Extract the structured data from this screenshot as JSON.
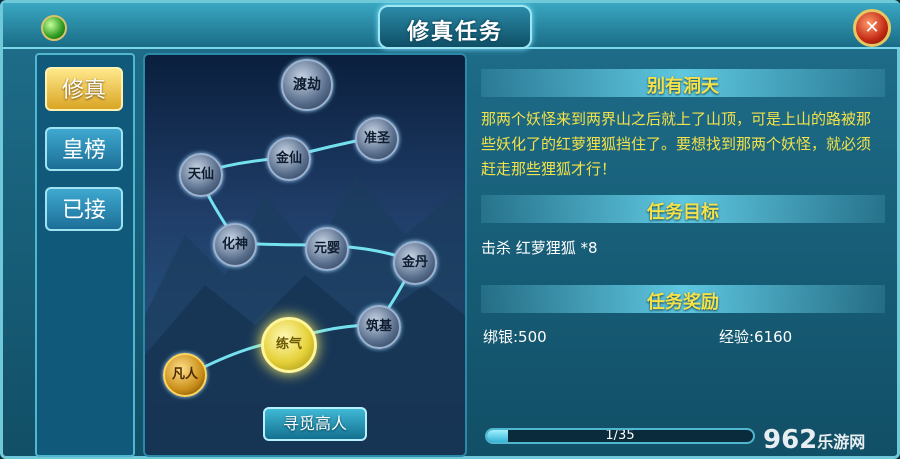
{
  "window": {
    "title": "修真任务",
    "close_icon": "✕"
  },
  "tabs": [
    {
      "label": "修真",
      "active": true
    },
    {
      "label": "皇榜",
      "active": false
    },
    {
      "label": "已接",
      "active": false
    }
  ],
  "map": {
    "nodes": [
      "渡劫",
      "准圣",
      "金仙",
      "天仙",
      "化神",
      "元婴",
      "金丹",
      "筑基",
      "练气",
      "凡人"
    ],
    "seek_button": "寻觅高人"
  },
  "quest": {
    "name": "别有洞天",
    "story": "那两个妖怪来到两界山之后就上了山顶，可是上山的路被那些妖化了的红萝狸狐挡住了。要想找到那两个妖怪，就必须赶走那些狸狐才行！",
    "target_header": "任务目标",
    "target": "击杀 红萝狸狐 *8",
    "reward_header": "任务奖励",
    "reward_silver": "绑银:500",
    "reward_exp": "经验:6160"
  },
  "progress": {
    "text": "1/35",
    "value": 0.0286
  },
  "watermark": {
    "main": "962",
    "sub": "乐游网"
  }
}
